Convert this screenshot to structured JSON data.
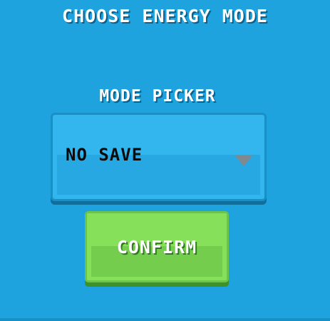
{
  "dialog": {
    "title": "CHOOSE ENERGY MODE"
  },
  "picker": {
    "label": "MODE PICKER",
    "selected_value": "NO SAVE",
    "caret_icon": "chevron-down-icon"
  },
  "confirm": {
    "label": "CONFIRM"
  },
  "colors": {
    "background": "#1fa3df",
    "dropdown": "#33b6ee",
    "confirm_button": "#86e05a",
    "text": "#ffffff",
    "value_text": "#0b0b0b"
  }
}
